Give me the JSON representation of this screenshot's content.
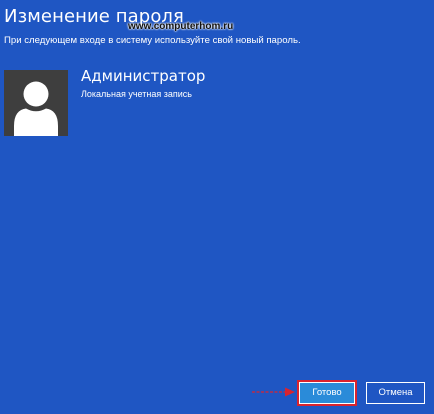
{
  "window": {
    "title": "Изменение пароля",
    "instruction": "При следующем входе в систему используйте свой новый пароль."
  },
  "watermark": "www.computerhom.ru",
  "user": {
    "name": "Администратор",
    "account_type": "Локальная учетная запись",
    "avatar_icon": "user-silhouette-icon"
  },
  "buttons": {
    "done_label": "Готово",
    "cancel_label": "Отмена"
  },
  "colors": {
    "background": "#1f56c3",
    "done_button": "#2a8bd9",
    "highlight": "#d9232f"
  }
}
